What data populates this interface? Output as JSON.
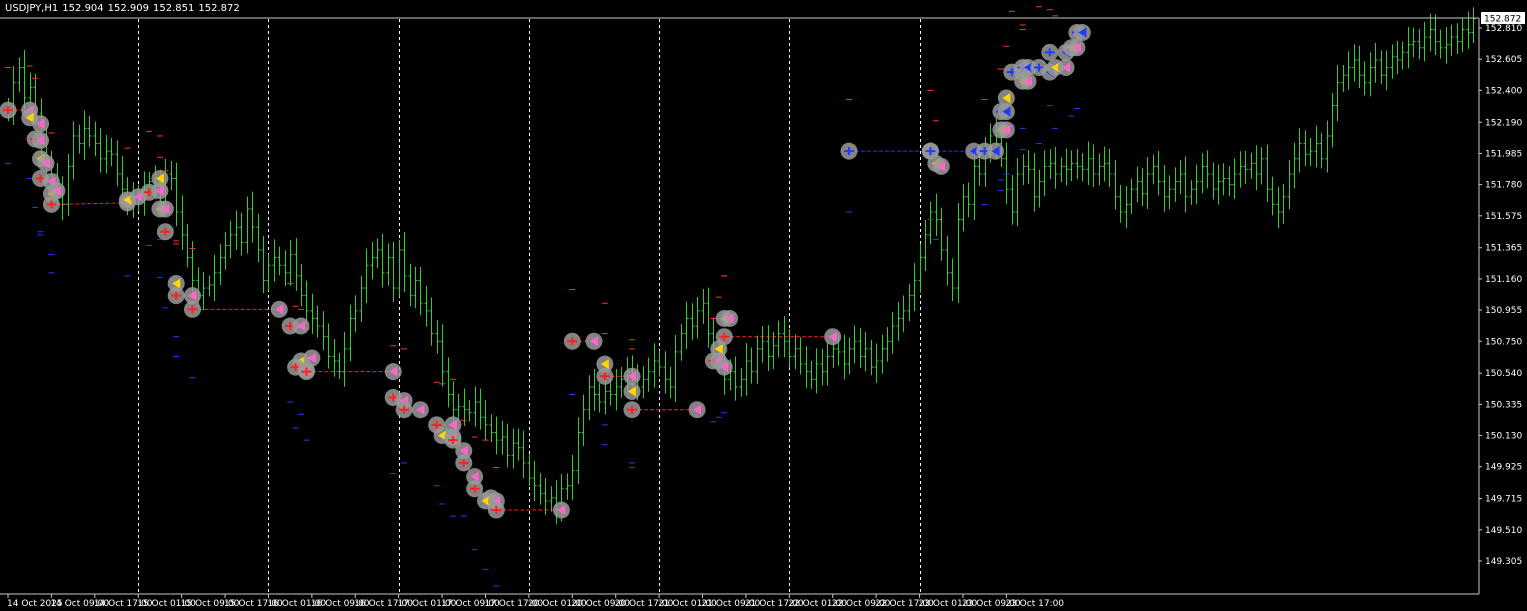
{
  "symbol_label": "USDJPY,H1",
  "ohlc": {
    "open": "152.904",
    "high": "152.909",
    "low": "152.851",
    "close": "152.872"
  },
  "current_price_tag": "152.872",
  "colors": {
    "background": "#000000",
    "grid_axis": "#c8c8c8",
    "bar": "#32cd32",
    "marker_halo": "#9a9a9a",
    "buy_arrow": "#ff2020",
    "sell_arrow": "#ffd700",
    "sell_line": "#ff2020",
    "buy_blue": "#1e3cff",
    "magenta": "#ff66cc"
  },
  "chart_data": {
    "type": "ohlc-bar",
    "price_axis": {
      "labels": [
        "152.810",
        "152.605",
        "152.400",
        "152.190",
        "151.985",
        "151.780",
        "151.575",
        "151.365",
        "151.160",
        "150.955",
        "150.750",
        "150.540",
        "150.335",
        "150.130",
        "149.925",
        "149.715",
        "149.510",
        "149.305"
      ],
      "range": [
        149.305,
        152.872
      ]
    },
    "time_axis": {
      "labels": [
        "14 Oct 2025",
        "14 Oct 09:00",
        "14 Oct 17:00",
        "15 Oct 01:00",
        "15 Oct 09:00",
        "15 Oct 17:00",
        "16 Oct 01:00",
        "16 Oct 09:00",
        "16 Oct 17:00",
        "17 Oct 01:00",
        "17 Oct 09:00",
        "17 Oct 17:00",
        "20 Oct 01:00",
        "20 Oct 09:00",
        "20 Oct 17:00",
        "21 Oct 01:00",
        "21 Oct 09:00",
        "21 Oct 17:00",
        "22 Oct 01:00",
        "22 Oct 09:00",
        "22 Oct 17:00",
        "23 Oct 01:00",
        "23 Oct 09:00",
        "23 Oct 17:00"
      ]
    },
    "session_separators": [
      "15 Oct 01:00",
      "16 Oct 01:00",
      "17 Oct 01:00",
      "20 Oct 01:00",
      "21 Oct 01:00",
      "22 Oct 01:00",
      "23 Oct 01:00"
    ],
    "closes_hourly": [
      152.27,
      152.45,
      152.55,
      152.35,
      152.42,
      152.25,
      152.05,
      151.9,
      151.85,
      151.72,
      151.65,
      151.9,
      152.1,
      152.05,
      152.15,
      152.1,
      152.05,
      151.95,
      152.0,
      151.98,
      151.85,
      151.75,
      151.65,
      151.7,
      151.68,
      151.75,
      151.8,
      151.78,
      151.75,
      151.85,
      151.82,
      151.6,
      151.45,
      151.3,
      151.15,
      151.05,
      151.1,
      151.12,
      151.2,
      151.3,
      151.38,
      151.45,
      151.5,
      151.4,
      151.62,
      151.5,
      151.35,
      151.15,
      151.25,
      151.3,
      151.25,
      151.2,
      151.32,
      151.18,
      151.05,
      150.95,
      150.9,
      150.85,
      150.78,
      150.65,
      150.62,
      150.55,
      150.7,
      150.9,
      150.95,
      151.1,
      151.25,
      151.3,
      151.35,
      151.2,
      151.3,
      151.1,
      151.35,
      151.18,
      151.05,
      151.15,
      151.0,
      150.95,
      150.8,
      150.75,
      150.55,
      150.4,
      150.3,
      150.32,
      150.3,
      150.28,
      150.35,
      150.25,
      150.2,
      150.15,
      150.1,
      150.12,
      150.0,
      150.08,
      150.05,
      149.95,
      149.85,
      149.8,
      149.75,
      149.7,
      149.72,
      149.65,
      149.78,
      149.8,
      149.9,
      150.15,
      150.3,
      150.45,
      150.4,
      150.35,
      150.42,
      150.4,
      150.45,
      150.5,
      150.55,
      150.5,
      150.45,
      150.5,
      150.55,
      150.62,
      150.58,
      150.5,
      150.45,
      150.68,
      150.8,
      150.9,
      150.85,
      150.95,
      151.0,
      150.8,
      150.7,
      150.6,
      150.5,
      150.55,
      150.45,
      150.5,
      150.62,
      150.55,
      150.7,
      150.75,
      150.65,
      150.72,
      150.8,
      150.75,
      150.65,
      150.7,
      150.6,
      150.55,
      150.5,
      150.6,
      150.55,
      150.65,
      150.7,
      150.68,
      150.6,
      150.7,
      150.75,
      150.65,
      150.7,
      150.58,
      150.62,
      150.7,
      150.75,
      150.85,
      150.9,
      150.95,
      151.05,
      151.15,
      151.3,
      151.45,
      151.6,
      151.55,
      151.35,
      151.2,
      151.1,
      151.55,
      151.7,
      151.65,
      151.9,
      151.85,
      152.0,
      152.1,
      152.05,
      151.95,
      151.75,
      151.6,
      151.85,
      151.9,
      151.88,
      151.7,
      151.8,
      151.9,
      151.92,
      151.85,
      151.9,
      151.88,
      151.92,
      151.9,
      151.88,
      151.95,
      151.85,
      151.9,
      151.92,
      151.85,
      151.7,
      151.6,
      151.65,
      151.75,
      151.8,
      151.72,
      151.85,
      151.9,
      151.8,
      151.7,
      151.75,
      151.8,
      151.85,
      151.7,
      151.75,
      151.8,
      151.9,
      151.85,
      151.75,
      151.8,
      151.82,
      151.78,
      151.85,
      151.9,
      151.88,
      151.92,
      151.85,
      151.95,
      151.75,
      151.65,
      151.6,
      151.7,
      151.85,
      151.95,
      152.05,
      151.98,
      152.0,
      152.05,
      151.95,
      152.1,
      152.3,
      152.45,
      152.5,
      152.55,
      152.6,
      152.5,
      152.45,
      152.55,
      152.6,
      152.5,
      152.55,
      152.62,
      152.6,
      152.65,
      152.7,
      152.72,
      152.68,
      152.75,
      152.8,
      152.72,
      152.68,
      152.7,
      152.75,
      152.72,
      152.8,
      152.78,
      152.87
    ],
    "positions": [
      {
        "entry_bar": 0,
        "entry": 152.27,
        "exit_bar": 4,
        "exit": 152.27,
        "side": "buy"
      },
      {
        "entry_bar": 4,
        "entry": 152.22,
        "exit_bar": 6,
        "exit": 152.18,
        "side": "sell"
      },
      {
        "entry_bar": 5,
        "entry": 152.08,
        "exit_bar": 6,
        "exit": 152.07,
        "side": "buy"
      },
      {
        "entry_bar": 6,
        "entry": 151.95,
        "exit_bar": 7,
        "exit": 151.92,
        "side": "sell"
      },
      {
        "entry_bar": 6,
        "entry": 151.82,
        "exit_bar": 8,
        "exit": 151.8,
        "side": "buy"
      },
      {
        "entry_bar": 8,
        "entry": 151.72,
        "exit_bar": 9,
        "exit": 151.74,
        "side": "sell"
      },
      {
        "entry_bar": 8,
        "entry": 151.65,
        "exit_bar": 22,
        "exit": 151.66,
        "side": "buy"
      },
      {
        "entry_bar": 22,
        "entry": 151.68,
        "exit_bar": 24,
        "exit": 151.7,
        "side": "sell"
      },
      {
        "entry_bar": 26,
        "entry": 151.73,
        "exit_bar": 28,
        "exit": 151.74,
        "side": "buy"
      },
      {
        "entry_bar": 28,
        "entry": 151.82,
        "exit_bar": 28,
        "exit": 151.84,
        "side": "sell"
      },
      {
        "entry_bar": 28,
        "entry": 151.62,
        "exit_bar": 29,
        "exit": 151.62,
        "side": "sell"
      },
      {
        "entry_bar": 29,
        "entry": 151.47,
        "exit_bar": 29,
        "exit": 151.46,
        "side": "buy"
      },
      {
        "entry_bar": 31,
        "entry": 151.13,
        "exit_bar": 31,
        "exit": 151.13,
        "side": "sell"
      },
      {
        "entry_bar": 31,
        "entry": 151.05,
        "exit_bar": 34,
        "exit": 151.05,
        "side": "buy"
      },
      {
        "entry_bar": 34,
        "entry": 150.96,
        "exit_bar": 50,
        "exit": 150.96,
        "side": "buy"
      },
      {
        "entry_bar": 52,
        "entry": 150.85,
        "exit_bar": 54,
        "exit": 150.85,
        "side": "buy"
      },
      {
        "entry_bar": 54,
        "entry": 150.62,
        "exit_bar": 56,
        "exit": 150.64,
        "side": "sell"
      },
      {
        "entry_bar": 53,
        "entry": 150.58,
        "exit_bar": 55,
        "exit": 150.56,
        "side": "buy"
      },
      {
        "entry_bar": 55,
        "entry": 150.55,
        "exit_bar": 71,
        "exit": 150.55,
        "side": "buy"
      },
      {
        "entry_bar": 71,
        "entry": 150.38,
        "exit_bar": 73,
        "exit": 150.36,
        "side": "buy"
      },
      {
        "entry_bar": 73,
        "entry": 150.3,
        "exit_bar": 76,
        "exit": 150.3,
        "side": "buy"
      },
      {
        "entry_bar": 79,
        "entry": 150.2,
        "exit_bar": 82,
        "exit": 150.2,
        "side": "buy"
      },
      {
        "entry_bar": 80,
        "entry": 150.13,
        "exit_bar": 82,
        "exit": 150.12,
        "side": "sell"
      },
      {
        "entry_bar": 82,
        "entry": 150.1,
        "exit_bar": 84,
        "exit": 150.03,
        "side": "buy"
      },
      {
        "entry_bar": 84,
        "entry": 149.95,
        "exit_bar": 86,
        "exit": 149.86,
        "side": "buy"
      },
      {
        "entry_bar": 86,
        "entry": 149.78,
        "exit_bar": 89,
        "exit": 149.72,
        "side": "buy"
      },
      {
        "entry_bar": 88,
        "entry": 149.7,
        "exit_bar": 90,
        "exit": 149.7,
        "side": "sell"
      },
      {
        "entry_bar": 90,
        "entry": 149.64,
        "exit_bar": 102,
        "exit": 149.64,
        "side": "buy"
      },
      {
        "entry_bar": 104,
        "entry": 150.75,
        "exit_bar": 108,
        "exit": 150.75,
        "side": "buy"
      },
      {
        "entry_bar": 110,
        "entry": 150.6,
        "exit_bar": 110,
        "exit": 150.62,
        "side": "sell"
      },
      {
        "entry_bar": 110,
        "entry": 150.52,
        "exit_bar": 115,
        "exit": 150.52,
        "side": "buy"
      },
      {
        "entry_bar": 115,
        "entry": 150.42,
        "exit_bar": 115,
        "exit": 150.42,
        "side": "sell"
      },
      {
        "entry_bar": 115,
        "entry": 150.3,
        "exit_bar": 127,
        "exit": 150.3,
        "side": "buy"
      },
      {
        "entry_bar": 130,
        "entry": 150.62,
        "exit_bar": 131,
        "exit": 150.62,
        "side": "buy"
      },
      {
        "entry_bar": 131,
        "entry": 150.7,
        "exit_bar": 132,
        "exit": 150.58,
        "side": "sell"
      },
      {
        "entry_bar": 132,
        "entry": 150.78,
        "exit_bar": 152,
        "exit": 150.78,
        "side": "buy"
      },
      {
        "entry_bar": 132,
        "entry": 150.9,
        "exit_bar": 133,
        "exit": 150.9,
        "side": "sell"
      },
      {
        "entry_bar": 155,
        "entry": 152.0,
        "exit_bar": 170,
        "exit": 152.0,
        "side": "blue"
      },
      {
        "entry_bar": 170,
        "entry": 152.0,
        "exit_bar": 178,
        "exit": 152.0,
        "side": "blue"
      },
      {
        "entry_bar": 171,
        "entry": 151.92,
        "exit_bar": 172,
        "exit": 151.9,
        "side": "sell"
      },
      {
        "entry_bar": 180,
        "entry": 152.0,
        "exit_bar": 182,
        "exit": 152.0,
        "side": "blue"
      },
      {
        "entry_bar": 183,
        "entry": 152.14,
        "exit_bar": 184,
        "exit": 152.14,
        "side": "sell"
      },
      {
        "entry_bar": 183,
        "entry": 152.26,
        "exit_bar": 184,
        "exit": 152.26,
        "side": "blue"
      },
      {
        "entry_bar": 184,
        "entry": 152.35,
        "exit_bar": 184,
        "exit": 152.35,
        "side": "sell"
      },
      {
        "entry_bar": 185,
        "entry": 152.52,
        "exit_bar": 187,
        "exit": 152.52,
        "side": "blue"
      },
      {
        "entry_bar": 187,
        "entry": 152.55,
        "exit_bar": 188,
        "exit": 152.55,
        "side": "blue"
      },
      {
        "entry_bar": 187,
        "entry": 152.46,
        "exit_bar": 188,
        "exit": 152.46,
        "side": "sell"
      },
      {
        "entry_bar": 190,
        "entry": 152.55,
        "exit_bar": 192,
        "exit": 152.52,
        "side": "blue"
      },
      {
        "entry_bar": 192,
        "entry": 152.65,
        "exit_bar": 195,
        "exit": 152.65,
        "side": "blue"
      },
      {
        "entry_bar": 193,
        "entry": 152.55,
        "exit_bar": 195,
        "exit": 152.55,
        "side": "sell"
      },
      {
        "entry_bar": 196,
        "entry": 152.68,
        "exit_bar": 197,
        "exit": 152.68,
        "side": "sell"
      },
      {
        "entry_bar": 197,
        "entry": 152.78,
        "exit_bar": 198,
        "exit": 152.78,
        "side": "blue"
      }
    ],
    "grid": false
  }
}
